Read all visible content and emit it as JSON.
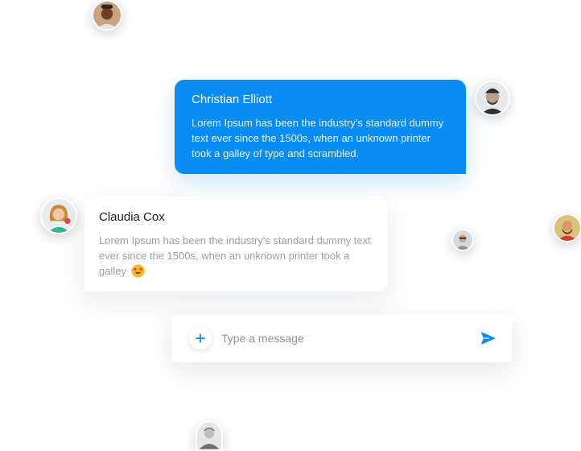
{
  "messages": [
    {
      "author": "Christian Elliott",
      "text": "Lorem Ipsum has been the industry's standard dummy text ever since the 1500s, when an unknown printer took a galley of type and scrambled.",
      "style": "sent",
      "color": "#0a8cf5"
    },
    {
      "author": "Claudia Cox",
      "text": "Lorem Ipsum has been the industry's standard dummy text ever since the 1500s, when an unknown printer took a galley",
      "emoji": "heart-eyes-emoji",
      "style": "received"
    }
  ],
  "composer": {
    "placeholder": "Type a message",
    "add_icon": "plus-icon",
    "send_icon": "send-icon"
  },
  "accent_color": "#0a8cf5"
}
